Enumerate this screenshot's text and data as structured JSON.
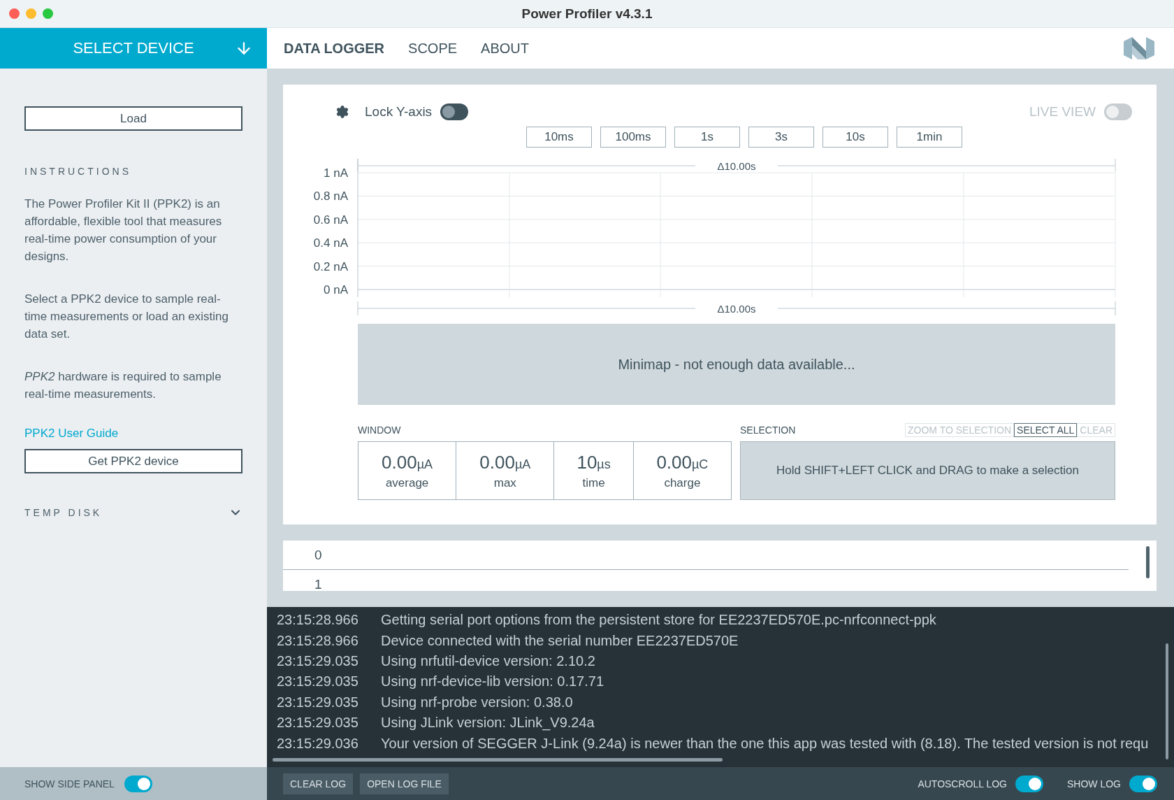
{
  "window": {
    "title": "Power Profiler v4.3.1"
  },
  "device_selector": {
    "label": "SELECT DEVICE"
  },
  "tabs": [
    {
      "label": "DATA LOGGER",
      "selected": true
    },
    {
      "label": "SCOPE",
      "selected": false
    },
    {
      "label": "ABOUT",
      "selected": false
    }
  ],
  "sidebar": {
    "load_button": "Load",
    "instructions": {
      "heading": "INSTRUCTIONS",
      "paragraphs": [
        "The Power Profiler Kit II (PPK2) is an affordable, flexible tool that measures real-time power consumption of your designs.",
        "Select a PPK2 device to sample real-time measurements or load an existing data set.",
        "*PPK2* hardware is required to sample real-time measurements."
      ]
    },
    "user_guide_link": "PPK2 User Guide",
    "get_device_button": "Get PPK2 device",
    "temp_disk": {
      "heading": "TEMP DISK",
      "expanded": false
    },
    "show_side_panel": {
      "label": "SHOW SIDE PANEL",
      "on": true
    }
  },
  "chart_toolbar": {
    "lock_y_axis": {
      "label": "Lock Y-axis",
      "on": false
    },
    "live_view": {
      "label": "LIVE VIEW",
      "on": false,
      "disabled": true
    }
  },
  "time_buttons": [
    "10ms",
    "100ms",
    "1s",
    "3s",
    "10s",
    "1min"
  ],
  "chart": {
    "span_top": "Δ10.00s",
    "span_bottom": "Δ10.00s",
    "y_axis_labels": [
      "1 nA",
      "0.8 nA",
      "0.6 nA",
      "0.4 nA",
      "0.2 nA",
      "0 nA"
    ]
  },
  "minimap": {
    "message": "Minimap - not enough data available..."
  },
  "window_stats": {
    "heading": "WINDOW",
    "items": [
      {
        "value": "0.00",
        "unit": "µA",
        "label": "average"
      },
      {
        "value": "0.00",
        "unit": "µA",
        "label": "max"
      },
      {
        "value": "10",
        "unit": "µs",
        "label": "time"
      },
      {
        "value": "0.00",
        "unit": "µC",
        "label": "charge"
      }
    ]
  },
  "selection": {
    "heading": "SELECTION",
    "buttons": [
      {
        "label": "ZOOM TO SELECTION",
        "disabled": true
      },
      {
        "label": "SELECT ALL",
        "disabled": false
      },
      {
        "label": "CLEAR",
        "disabled": true
      }
    ],
    "hint": "Hold SHIFT+LEFT CLICK and DRAG to make a selection"
  },
  "digital_channels": [
    "0",
    "1"
  ],
  "log": [
    {
      "time": "23:15:28.966",
      "message": "Getting serial port options from the persistent store for EE2237ED570E.pc-nrfconnect-ppk"
    },
    {
      "time": "23:15:28.966",
      "message": "Device connected with the serial number EE2237ED570E"
    },
    {
      "time": "23:15:29.035",
      "message": "Using nrfutil-device version: 2.10.2"
    },
    {
      "time": "23:15:29.035",
      "message": "Using nrf-device-lib version: 0.17.71"
    },
    {
      "time": "23:15:29.035",
      "message": "Using nrf-probe version: 0.38.0"
    },
    {
      "time": "23:15:29.035",
      "message": "Using JLink version: JLink_V9.24a"
    },
    {
      "time": "23:15:29.036",
      "message": "Your version of SEGGER J-Link (9.24a) is newer than the one this app was tested with (8.18). The tested version is not requ"
    }
  ],
  "log_bar": {
    "buttons": [
      "CLEAR LOG",
      "OPEN LOG FILE"
    ],
    "toggles": [
      {
        "label": "AUTOSCROLL LOG",
        "on": true
      },
      {
        "label": "SHOW LOG",
        "on": true
      }
    ]
  }
}
